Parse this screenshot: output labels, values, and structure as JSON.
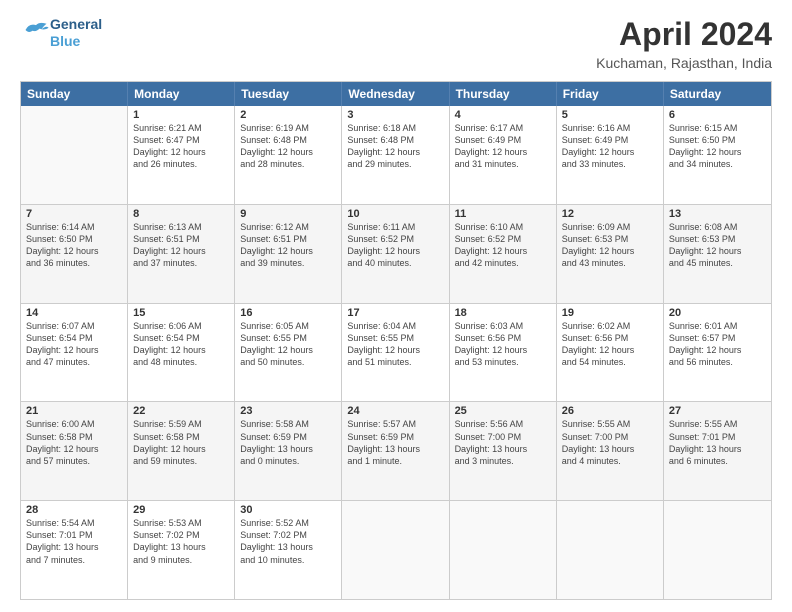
{
  "header": {
    "logo_line1": "General",
    "logo_line2": "Blue",
    "title": "April 2024",
    "subtitle": "Kuchaman, Rajasthan, India"
  },
  "days": [
    "Sunday",
    "Monday",
    "Tuesday",
    "Wednesday",
    "Thursday",
    "Friday",
    "Saturday"
  ],
  "weeks": [
    [
      {
        "date": "",
        "info": ""
      },
      {
        "date": "1",
        "info": "Sunrise: 6:21 AM\nSunset: 6:47 PM\nDaylight: 12 hours\nand 26 minutes."
      },
      {
        "date": "2",
        "info": "Sunrise: 6:19 AM\nSunset: 6:48 PM\nDaylight: 12 hours\nand 28 minutes."
      },
      {
        "date": "3",
        "info": "Sunrise: 6:18 AM\nSunset: 6:48 PM\nDaylight: 12 hours\nand 29 minutes."
      },
      {
        "date": "4",
        "info": "Sunrise: 6:17 AM\nSunset: 6:49 PM\nDaylight: 12 hours\nand 31 minutes."
      },
      {
        "date": "5",
        "info": "Sunrise: 6:16 AM\nSunset: 6:49 PM\nDaylight: 12 hours\nand 33 minutes."
      },
      {
        "date": "6",
        "info": "Sunrise: 6:15 AM\nSunset: 6:50 PM\nDaylight: 12 hours\nand 34 minutes."
      }
    ],
    [
      {
        "date": "7",
        "info": "Sunrise: 6:14 AM\nSunset: 6:50 PM\nDaylight: 12 hours\nand 36 minutes."
      },
      {
        "date": "8",
        "info": "Sunrise: 6:13 AM\nSunset: 6:51 PM\nDaylight: 12 hours\nand 37 minutes."
      },
      {
        "date": "9",
        "info": "Sunrise: 6:12 AM\nSunset: 6:51 PM\nDaylight: 12 hours\nand 39 minutes."
      },
      {
        "date": "10",
        "info": "Sunrise: 6:11 AM\nSunset: 6:52 PM\nDaylight: 12 hours\nand 40 minutes."
      },
      {
        "date": "11",
        "info": "Sunrise: 6:10 AM\nSunset: 6:52 PM\nDaylight: 12 hours\nand 42 minutes."
      },
      {
        "date": "12",
        "info": "Sunrise: 6:09 AM\nSunset: 6:53 PM\nDaylight: 12 hours\nand 43 minutes."
      },
      {
        "date": "13",
        "info": "Sunrise: 6:08 AM\nSunset: 6:53 PM\nDaylight: 12 hours\nand 45 minutes."
      }
    ],
    [
      {
        "date": "14",
        "info": "Sunrise: 6:07 AM\nSunset: 6:54 PM\nDaylight: 12 hours\nand 47 minutes."
      },
      {
        "date": "15",
        "info": "Sunrise: 6:06 AM\nSunset: 6:54 PM\nDaylight: 12 hours\nand 48 minutes."
      },
      {
        "date": "16",
        "info": "Sunrise: 6:05 AM\nSunset: 6:55 PM\nDaylight: 12 hours\nand 50 minutes."
      },
      {
        "date": "17",
        "info": "Sunrise: 6:04 AM\nSunset: 6:55 PM\nDaylight: 12 hours\nand 51 minutes."
      },
      {
        "date": "18",
        "info": "Sunrise: 6:03 AM\nSunset: 6:56 PM\nDaylight: 12 hours\nand 53 minutes."
      },
      {
        "date": "19",
        "info": "Sunrise: 6:02 AM\nSunset: 6:56 PM\nDaylight: 12 hours\nand 54 minutes."
      },
      {
        "date": "20",
        "info": "Sunrise: 6:01 AM\nSunset: 6:57 PM\nDaylight: 12 hours\nand 56 minutes."
      }
    ],
    [
      {
        "date": "21",
        "info": "Sunrise: 6:00 AM\nSunset: 6:58 PM\nDaylight: 12 hours\nand 57 minutes."
      },
      {
        "date": "22",
        "info": "Sunrise: 5:59 AM\nSunset: 6:58 PM\nDaylight: 12 hours\nand 59 minutes."
      },
      {
        "date": "23",
        "info": "Sunrise: 5:58 AM\nSunset: 6:59 PM\nDaylight: 13 hours\nand 0 minutes."
      },
      {
        "date": "24",
        "info": "Sunrise: 5:57 AM\nSunset: 6:59 PM\nDaylight: 13 hours\nand 1 minute."
      },
      {
        "date": "25",
        "info": "Sunrise: 5:56 AM\nSunset: 7:00 PM\nDaylight: 13 hours\nand 3 minutes."
      },
      {
        "date": "26",
        "info": "Sunrise: 5:55 AM\nSunset: 7:00 PM\nDaylight: 13 hours\nand 4 minutes."
      },
      {
        "date": "27",
        "info": "Sunrise: 5:55 AM\nSunset: 7:01 PM\nDaylight: 13 hours\nand 6 minutes."
      }
    ],
    [
      {
        "date": "28",
        "info": "Sunrise: 5:54 AM\nSunset: 7:01 PM\nDaylight: 13 hours\nand 7 minutes."
      },
      {
        "date": "29",
        "info": "Sunrise: 5:53 AM\nSunset: 7:02 PM\nDaylight: 13 hours\nand 9 minutes."
      },
      {
        "date": "30",
        "info": "Sunrise: 5:52 AM\nSunset: 7:02 PM\nDaylight: 13 hours\nand 10 minutes."
      },
      {
        "date": "",
        "info": ""
      },
      {
        "date": "",
        "info": ""
      },
      {
        "date": "",
        "info": ""
      },
      {
        "date": "",
        "info": ""
      }
    ]
  ]
}
